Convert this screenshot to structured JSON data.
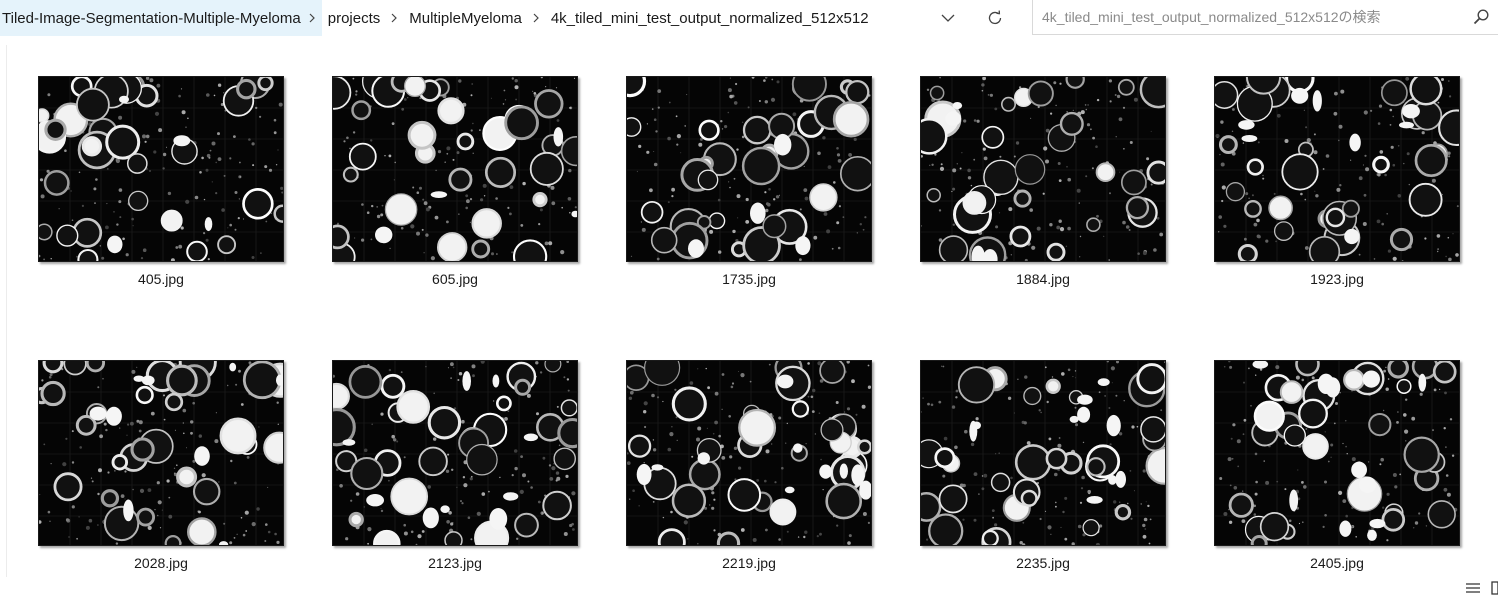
{
  "breadcrumb": {
    "items": [
      "Tiled-Image-Segmentation-Multiple-Myeloma",
      "projects",
      "MultipleMyeloma",
      "4k_tiled_mini_test_output_normalized_512x512"
    ]
  },
  "search": {
    "placeholder": "4k_tiled_mini_test_output_normalized_512x512の検索",
    "value": ""
  },
  "icons": {
    "dropdown": "chevron-down-icon",
    "refresh": "refresh-icon",
    "search": "search-icon",
    "details_view": "details-view-icon",
    "large_icons_view": "large-icons-view-icon"
  },
  "files": [
    {
      "name": "405.jpg"
    },
    {
      "name": "605.jpg"
    },
    {
      "name": "1735.jpg"
    },
    {
      "name": "1884.jpg"
    },
    {
      "name": "1923.jpg"
    },
    {
      "name": "2028.jpg"
    },
    {
      "name": "2123.jpg"
    },
    {
      "name": "2219.jpg"
    },
    {
      "name": "2235.jpg"
    },
    {
      "name": "2405.jpg"
    }
  ],
  "colors": {
    "breadcrumb_highlight": "#e5f3fb",
    "thumbnail_background": "#050505",
    "cell_stroke": "#e8e8e8"
  }
}
